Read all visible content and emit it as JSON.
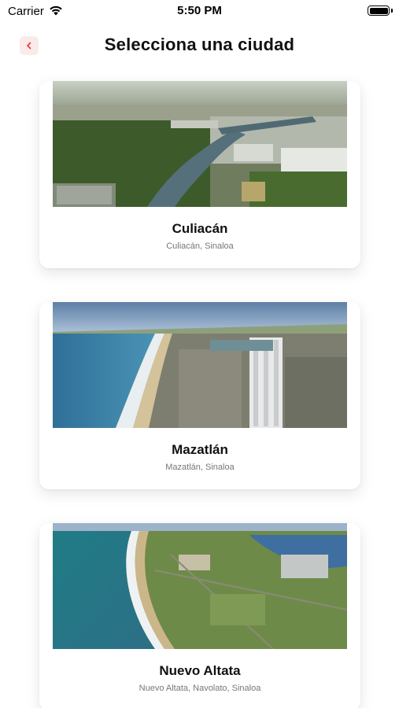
{
  "status_bar": {
    "carrier": "Carrier",
    "time": "5:50 PM"
  },
  "header": {
    "title": "Selecciona una ciudad",
    "back_icon": "chevron-left-icon",
    "accent_color": "#e53935"
  },
  "cities": [
    {
      "name": "Culiacán",
      "subtitle": "Culiacán, Sinaloa",
      "image": "aerial-city-river-photo"
    },
    {
      "name": "Mazatlán",
      "subtitle": "Mazatlán, Sinaloa",
      "image": "coastal-city-beach-photo"
    },
    {
      "name": "Nuevo Altata",
      "subtitle": "Nuevo Altata, Navolato, Sinaloa",
      "image": "coastline-development-photo"
    }
  ]
}
